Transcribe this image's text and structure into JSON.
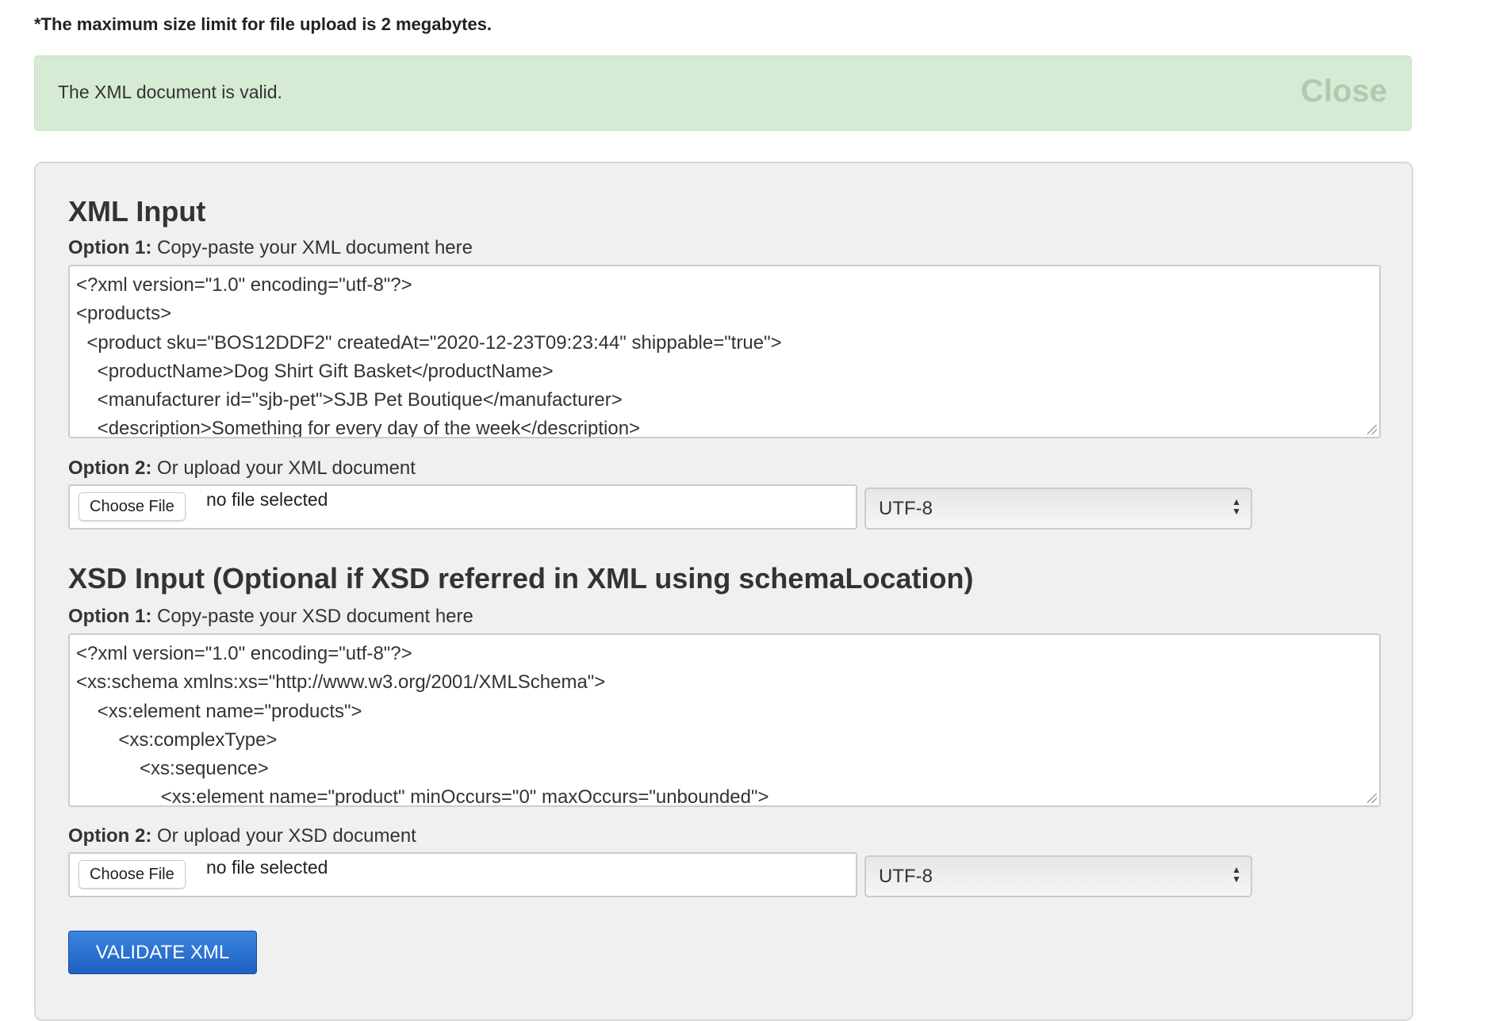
{
  "note": "*The maximum size limit for file upload is 2 megabytes.",
  "alert": {
    "message": "The XML document is valid.",
    "close_label": "Close",
    "color": "#d6ebd4"
  },
  "xml": {
    "heading": "XML Input",
    "option1_bold": "Option 1:",
    "option1_text": " Copy-paste your XML document here",
    "content": "<?xml version=\"1.0\" encoding=\"utf-8\"?>\n<products>\n  <product sku=\"BOS12DDF2\" createdAt=\"2020-12-23T09:23:44\" shippable=\"true\">\n    <productName>Dog Shirt Gift Basket</productName>\n    <manufacturer id=\"sjb-pet\">SJB Pet Boutique</manufacturer>\n    <description>Something for every day of the week</description>",
    "option2_bold": "Option 2:",
    "option2_text": " Or upload your XML document",
    "choose_file": "Choose File",
    "no_file": "no file selected",
    "encoding": "UTF-8"
  },
  "xsd": {
    "heading": "XSD Input (Optional if XSD referred in XML using schemaLocation)",
    "option1_bold": "Option 1:",
    "option1_text": " Copy-paste your XSD document here",
    "content": "<?xml version=\"1.0\" encoding=\"utf-8\"?>\n<xs:schema xmlns:xs=\"http://www.w3.org/2001/XMLSchema\">\n    <xs:element name=\"products\">\n        <xs:complexType>\n            <xs:sequence>\n                <xs:element name=\"product\" minOccurs=\"0\" maxOccurs=\"unbounded\">",
    "option2_bold": "Option 2:",
    "option2_text": " Or upload your XSD document",
    "choose_file": "Choose File",
    "no_file": "no file selected",
    "encoding": "UTF-8"
  },
  "validate_label": "VALIDATE XML",
  "accent_color": "#2a70d0"
}
